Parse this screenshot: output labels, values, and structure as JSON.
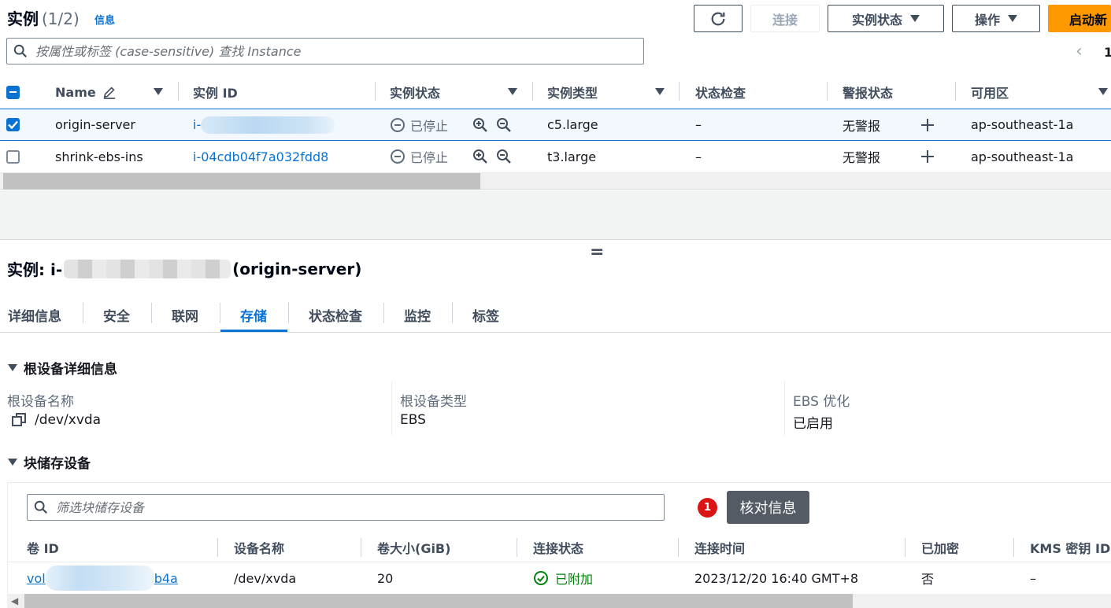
{
  "header": {
    "title": "实例",
    "count": "(1/2)",
    "info_link": "信息",
    "buttons": {
      "connect": "连接",
      "instance_state": "实例状态",
      "actions": "操作",
      "launch": "启动新"
    },
    "search_placeholder": "按属性或标签 (case-sensitive) 查找 Instance",
    "pager_prev": "‹",
    "pager_page": "1"
  },
  "instances_table": {
    "columns": [
      "Name",
      "实例 ID",
      "实例状态",
      "实例类型",
      "状态检查",
      "警报状态",
      "可用区"
    ],
    "rows": [
      {
        "selected": true,
        "name": "origin-server",
        "instance_id": "i-",
        "state": "已停止",
        "type": "c5.large",
        "status_check": "–",
        "alarm": "无警报",
        "az": "ap-southeast-1a"
      },
      {
        "selected": false,
        "name": "shrink-ebs-ins",
        "instance_id": "i-04cdb04f7a032fdd8",
        "state": "已停止",
        "type": "t3.large",
        "status_check": "–",
        "alarm": "无警报",
        "az": "ap-southeast-1a"
      }
    ]
  },
  "detail": {
    "drag_handle": "=",
    "title_prefix": "实例: i-",
    "title_suffix": "(origin-server)",
    "tabs": [
      "详细信息",
      "安全",
      "联网",
      "存储",
      "状态检查",
      "监控",
      "标签"
    ],
    "active_tab": "存储",
    "root_section": {
      "heading": "根设备详细信息",
      "items": [
        {
          "label": "根设备名称",
          "value": "/dev/xvda"
        },
        {
          "label": "根设备类型",
          "value": "EBS"
        },
        {
          "label": "EBS 优化",
          "value": "已启用"
        }
      ]
    },
    "block_section": {
      "heading": "块储存设备",
      "filter_placeholder": "筛选块储存设备",
      "badge": "1",
      "tooltip": "核对信息",
      "columns": [
        "卷 ID",
        "设备名称",
        "卷大小(GiB)",
        "连接状态",
        "连接时间",
        "已加密",
        "KMS 密钥 ID"
      ],
      "rows": [
        {
          "volume_prefix": "vol",
          "volume_suffix": "b4a",
          "device": "/dev/xvda",
          "size": "20",
          "attach_state": "已附加",
          "attach_time": "2023/12/20 16:40 GMT+8",
          "encrypted": "否",
          "kms": "–"
        }
      ]
    }
  },
  "colors": {
    "link": "#0972d3",
    "primary": "#ff9900",
    "success": "#037f0c",
    "badge": "#d91515",
    "tooltip_bg": "#545b64"
  }
}
